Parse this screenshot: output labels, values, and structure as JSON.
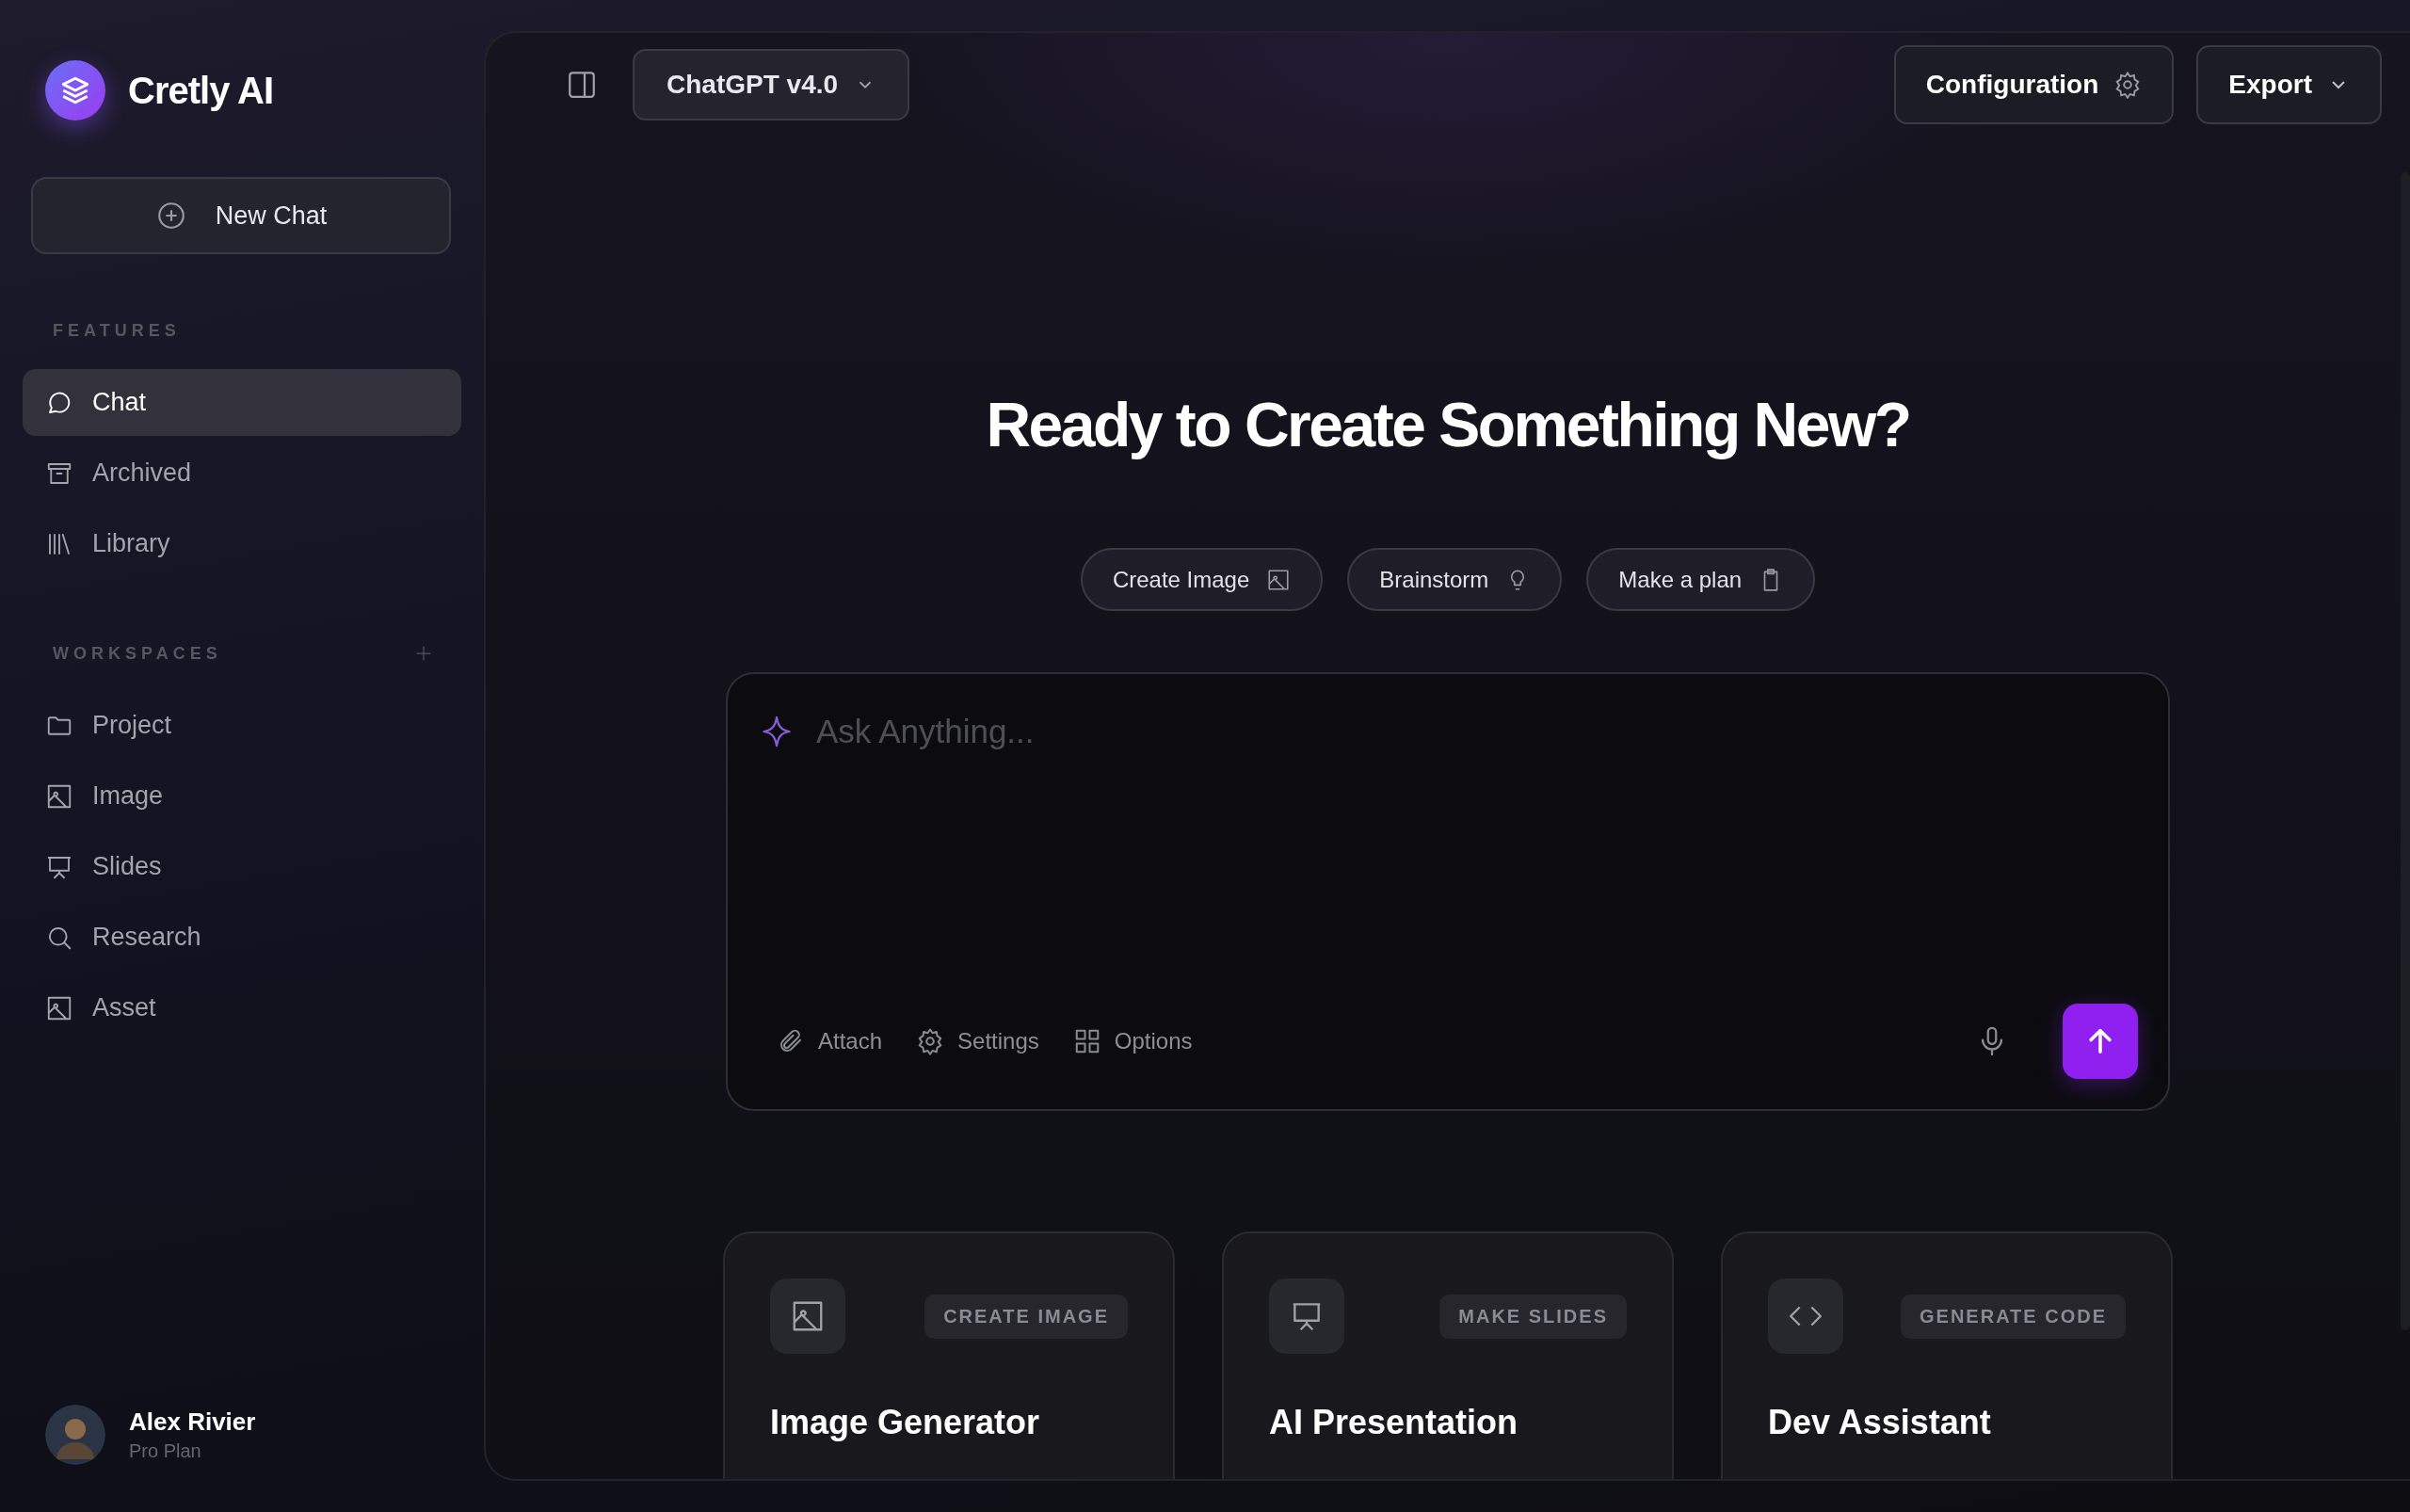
{
  "app": {
    "name": "Cretly AI"
  },
  "new_chat": {
    "label": "New Chat"
  },
  "sections": [
    {
      "title": "FEATURES",
      "items": [
        {
          "label": "Chat",
          "selected": true
        },
        {
          "label": "Archived",
          "selected": false
        },
        {
          "label": "Library",
          "selected": false
        }
      ]
    },
    {
      "title": "WORKSPACES",
      "items": [
        {
          "label": "Project",
          "selected": false
        },
        {
          "label": "Image",
          "selected": false
        },
        {
          "label": "Slides",
          "selected": false
        },
        {
          "label": "Research",
          "selected": false
        },
        {
          "label": "Asset",
          "selected": false
        }
      ]
    }
  ],
  "user": {
    "name": "Alex Rivier",
    "plan": "Pro Plan"
  },
  "topbar": {
    "model": "ChatGPT v4.0",
    "buttons": [
      {
        "label": "Configuration"
      },
      {
        "label": "Export"
      }
    ]
  },
  "heading": "Ready to Create Something New?",
  "chips": [
    {
      "label": "Create Image"
    },
    {
      "label": "Brainstorm"
    },
    {
      "label": "Make a plan"
    }
  ],
  "prompt": {
    "placeholder": "Ask Anything...",
    "tools": [
      {
        "label": "Attach"
      },
      {
        "label": "Settings"
      },
      {
        "label": "Options"
      }
    ]
  },
  "cards": [
    {
      "tag": "CREATE IMAGE",
      "title": "Image Generator"
    },
    {
      "tag": "MAKE SLIDES",
      "title": "AI Presentation"
    },
    {
      "tag": "GENERATE CODE",
      "title": "Dev Assistant"
    }
  ]
}
